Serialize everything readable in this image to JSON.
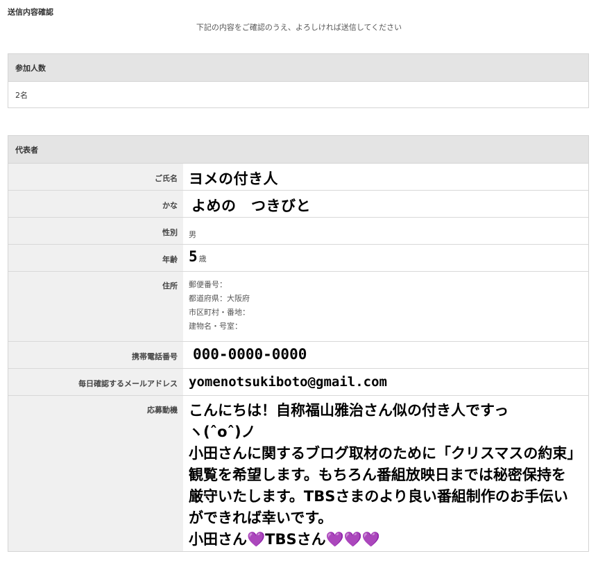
{
  "page_title": "送信内容確認",
  "subtitle": "下記の内容をご確認のうえ、よろしければ送信してください",
  "participants": {
    "header": "参加人数",
    "value": "2名"
  },
  "representative": {
    "header": "代表者",
    "name_label": "ご氏名",
    "name_value": "ヨメの付き人",
    "kana_label": "かな",
    "kana_value": "よめの　つきびと",
    "gender_label": "性別",
    "gender_value": "男",
    "age_label": "年齢",
    "age_value": "5",
    "age_unit": "歳",
    "address_label": "住所",
    "address_postal": "郵便番号：",
    "address_prefecture": "都道府県：大阪府",
    "address_city": "市区町村・番地：",
    "address_building": "建物名・号室：",
    "phone_label": "携帯電話番号",
    "phone_value": "000-0000-0000",
    "email_label": "毎日確認するメールアドレス",
    "email_value": "yomenotsukiboto@gmail.com",
    "motive_label": "応募動機",
    "motive_value": "こんにちは！自称福山雅治さん似の付き人ですっ\nヽ(ˆoˆ)ノ\n小田さんに関するブログ取材のために「クリスマスの約束」観覧を希望します。もちろん番組放映日までは秘密保持を厳守いたします。TBSさまのより良い番組制作のお手伝いができれば幸いです。\n小田さん💜TBSさん💜💜💜"
  }
}
